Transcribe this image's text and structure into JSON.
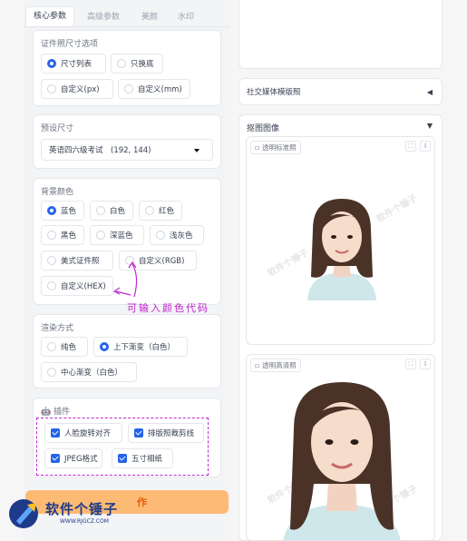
{
  "tabs": [
    {
      "label": "核心参数",
      "active": true
    },
    {
      "label": "高级参数",
      "active": false
    },
    {
      "label": "美颜",
      "active": false
    },
    {
      "label": "水印",
      "active": false
    }
  ],
  "size_options": {
    "title": "证件照尺寸选项",
    "options": [
      "尺寸列表",
      "只换底",
      "自定义(px)",
      "自定义(mm)"
    ],
    "selected": "尺寸列表"
  },
  "preset_size": {
    "title": "预设尺寸",
    "value": "英语四六级考试　(192, 144)"
  },
  "background": {
    "title": "背景颜色",
    "options": [
      "蓝色",
      "白色",
      "红色",
      "黑色",
      "深蓝色",
      "浅灰色",
      "美式证件照",
      "自定义(RGB)",
      "自定义(HEX)"
    ],
    "selected": "蓝色"
  },
  "annotation": "可输入颜色代码",
  "render": {
    "title": "渲染方式",
    "options": [
      "纯色",
      "上下渐变（白色）",
      "中心渐变（白色）"
    ],
    "selected": "上下渐变（白色）"
  },
  "plugins": {
    "title": "插件",
    "emoji": "🤖",
    "items": [
      "人脸旋转对齐",
      "排版照裁剪线",
      "JPEG格式",
      "五寸相纸"
    ]
  },
  "generate_label": "作",
  "right": {
    "social_label": "社交媒体模版照",
    "social_arrow": "◀",
    "cutout_label": "抠图图像",
    "cutout_arrow": "▼",
    "img1_label": "透明标准照",
    "img2_label": "透明高清照",
    "watermark": "软件个锤子"
  },
  "logo": {
    "name": "软件个锤子",
    "url": "WWW.RJGCZ.COM"
  },
  "colors": {
    "accent": "#2563eb",
    "annotation": "#c026d3",
    "generate_bg": "#fdba74"
  }
}
